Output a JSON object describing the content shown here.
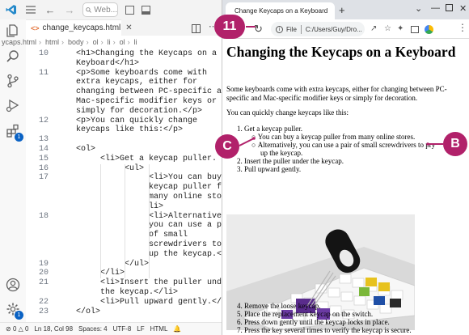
{
  "vscode": {
    "command_center": "Web...",
    "tab_label": "change_keycaps.html",
    "breadcrumbs": [
      "ycaps.html",
      "html",
      "body",
      "ol",
      "li",
      "ol",
      "li"
    ],
    "lines": [
      {
        "n": "10",
        "text": "<h1>Changing the Keycaps on a"
      },
      {
        "n": "",
        "text": "Keyboard</h1>"
      },
      {
        "n": "11",
        "text": "<p>Some keyboards come with"
      },
      {
        "n": "",
        "text": "extra keycaps, either for"
      },
      {
        "n": "",
        "text": "changing between PC-specific and"
      },
      {
        "n": "",
        "text": "Mac-specific modifier keys or"
      },
      {
        "n": "",
        "text": "simply for decoration.</p>"
      },
      {
        "n": "12",
        "text": "<p>You can quickly change"
      },
      {
        "n": "",
        "text": "keycaps like this:</p>"
      },
      {
        "n": "13",
        "text": ""
      },
      {
        "n": "14",
        "text": "<ol>"
      },
      {
        "n": "15",
        "text": "<li>Get a keycap puller."
      },
      {
        "n": "16",
        "text": "<ul>"
      },
      {
        "n": "17",
        "text": "<li>You can buy a"
      },
      {
        "n": "",
        "text": "keycap puller from"
      },
      {
        "n": "",
        "text": "many online stores.</"
      },
      {
        "n": "",
        "text": "li>"
      },
      {
        "n": "18",
        "text": "<li>Alternatively,"
      },
      {
        "n": "",
        "text": "you can use a pair"
      },
      {
        "n": "",
        "text": "of small"
      },
      {
        "n": "",
        "text": "screwdrivers to pry"
      },
      {
        "n": "",
        "text": "up the keycap.</li>"
      },
      {
        "n": "19",
        "text": "</ul>"
      },
      {
        "n": "20",
        "text": "</li>"
      },
      {
        "n": "21",
        "text": "<li>Insert the puller under"
      },
      {
        "n": "",
        "text": "the keycap.</li>"
      },
      {
        "n": "22",
        "text": "<li>Pull upward gently.</li>"
      },
      {
        "n": "23",
        "text": "</ol>"
      }
    ],
    "status": {
      "errors": "0",
      "warnings": "0",
      "position": "Ln 18, Col 98",
      "spaces": "Spaces: 4",
      "encoding": "UTF-8",
      "eol": "LF",
      "language": "HTML"
    },
    "badges": {
      "extensions": "1",
      "manage": "1"
    }
  },
  "browser": {
    "tab_title": "Change Keycaps on a Keyboard",
    "address_label": "File",
    "address_path": "C:/Users/Guy/Dro...",
    "page": {
      "h1": "Changing the Keycaps on a Keyboard",
      "p1": "Some keyboards come with extra keycaps, either for changing between PC-specific and Mac-specific modifier keys or simply for decoration.",
      "p2": "You can quickly change keycaps like this:",
      "list": [
        "1. Get a keycap puller.",
        "You can buy a keycap puller from many online stores.",
        "Alternatively, you can use a pair of small screwdrivers to pry",
        "up the keycap.",
        "2. Insert the puller under the keycap.",
        "3. Pull upward gently.",
        "4. Remove the loose keycap.",
        "5. Place the replacement keycap on the switch.",
        "6. Press down gently until the keycap locks in place.",
        "7. Press the key several times to verify the keycap is secure."
      ]
    }
  },
  "callouts": {
    "step": "11",
    "b": "B",
    "c": "C"
  },
  "colors": {
    "callout": "#b1216a",
    "vscode_blue": "#0a62c4"
  }
}
